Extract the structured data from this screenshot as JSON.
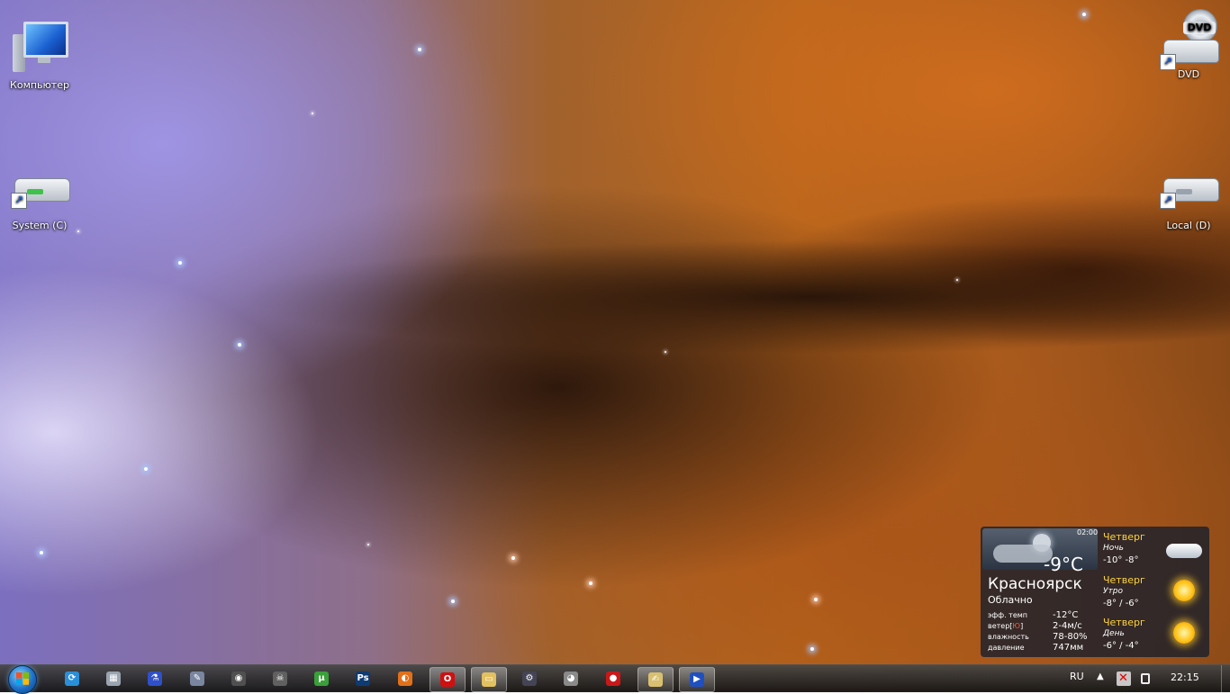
{
  "desktop": {
    "icons": [
      {
        "label": "Компьютер"
      },
      {
        "label": "System (C)"
      },
      {
        "label": "DVD"
      },
      {
        "label": "Local (D)"
      }
    ],
    "dvd_badge": "DVD"
  },
  "weather": {
    "time": "02:00",
    "temperature": "-9°C",
    "city": "Красноярск",
    "condition": "Облачно",
    "details": [
      {
        "key": "эфф. темп",
        "value": "-12°C"
      },
      {
        "key_pre": "ветер[",
        "key_hl": "Ю",
        "key_post": "]",
        "value": "2-4м/с"
      },
      {
        "key": "влажность",
        "value": "78-80%"
      },
      {
        "key": "давление",
        "value": "747мм"
      }
    ],
    "forecast": [
      {
        "day": "Четверг",
        "part": "Ночь",
        "range": "-10° -8°",
        "icon": "cloudy-icon"
      },
      {
        "day": "Четверг",
        "part": "Утро",
        "range": "-8° / -6°",
        "icon": "sunny-icon"
      },
      {
        "day": "Четверг",
        "part": "День",
        "range": "-6° / -4°",
        "icon": "sunny-icon"
      }
    ]
  },
  "taskbar": {
    "apps": [
      {
        "name": "sync-icon",
        "glyph": "⟳",
        "color": "#2a8fd8"
      },
      {
        "name": "calculator-icon",
        "glyph": "▦",
        "color": "#9aa4b0"
      },
      {
        "name": "flask-icon",
        "glyph": "⚗",
        "color": "#3050c8"
      },
      {
        "name": "tool-icon",
        "glyph": "✎",
        "color": "#7a86a0"
      },
      {
        "name": "eye-icon",
        "glyph": "◉",
        "color": "#505050"
      },
      {
        "name": "alien-icon",
        "glyph": "☠",
        "color": "#606060"
      },
      {
        "name": "utorrent-icon",
        "glyph": "µ",
        "color": "#3aa03a"
      },
      {
        "name": "photoshop-icon",
        "glyph": "Ps",
        "color": "#0e3b73"
      },
      {
        "name": "firefox-icon",
        "glyph": "◐",
        "color": "#e0701a"
      },
      {
        "name": "opera-icon",
        "glyph": "O",
        "color": "#d01010"
      },
      {
        "name": "explorer-icon",
        "glyph": "▭",
        "color": "#e3c060"
      },
      {
        "name": "steam-icon",
        "glyph": "⚙",
        "color": "#445"
      },
      {
        "name": "gimp-icon",
        "glyph": "◕",
        "color": "#8a8a8a"
      },
      {
        "name": "game-icon",
        "glyph": "●",
        "color": "#c81818"
      },
      {
        "name": "notepad-icon",
        "glyph": "✍",
        "color": "#d8c070"
      },
      {
        "name": "player-icon",
        "glyph": "▶",
        "color": "#2050c0"
      }
    ],
    "active_apps": [
      9,
      10,
      14,
      15
    ],
    "language": "RU",
    "clock": "22:15"
  }
}
